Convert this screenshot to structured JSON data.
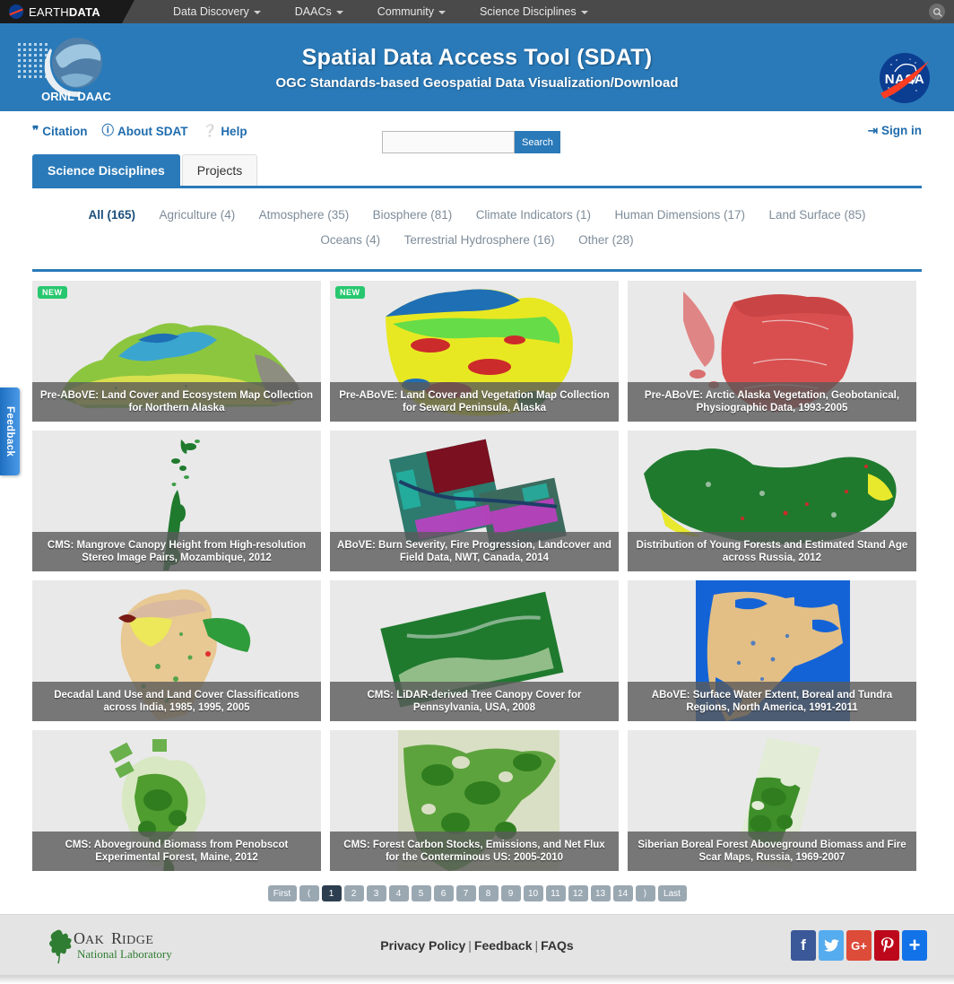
{
  "earthdata_bar": {
    "logo_text_light": "EARTH",
    "logo_text_bold": "DATA",
    "nav": [
      {
        "label": "Data Discovery",
        "has_caret": true
      },
      {
        "label": "DAACs",
        "has_caret": true
      },
      {
        "label": "Community",
        "has_caret": true
      },
      {
        "label": "Science Disciplines",
        "has_caret": true
      }
    ],
    "search_icon": "search-icon"
  },
  "banner": {
    "title": "Spatial Data Access Tool (SDAT)",
    "subtitle": "OGC Standards-based Geospatial Data Visualization/Download",
    "ornl_label": "ORNL DAAC",
    "nasa_label": "NASA",
    "background_color": "#2a7ab9"
  },
  "utility": {
    "links": [
      {
        "label": "Citation",
        "icon": "quote-icon"
      },
      {
        "label": "About SDAT",
        "icon": "info-circle-icon"
      },
      {
        "label": "Help",
        "icon": "question-circle-icon"
      }
    ],
    "sign_in": {
      "label": "Sign in",
      "icon": "sign-in-icon"
    },
    "link_color": "#1f6cad"
  },
  "search": {
    "value": "",
    "placeholder": "",
    "button_label": "Search"
  },
  "tabs": [
    {
      "label": "Science Disciplines",
      "active": true
    },
    {
      "label": "Projects",
      "active": false
    }
  ],
  "filters": [
    {
      "label": "All (165)",
      "active": true
    },
    {
      "label": "Agriculture (4)",
      "active": false
    },
    {
      "label": "Atmosphere (35)",
      "active": false
    },
    {
      "label": "Biosphere (81)",
      "active": false
    },
    {
      "label": "Climate Indicators (1)",
      "active": false
    },
    {
      "label": "Human Dimensions (17)",
      "active": false
    },
    {
      "label": "Land Surface (85)",
      "active": false
    },
    {
      "label": "Oceans (4)",
      "active": false
    },
    {
      "label": "Terrestrial Hydrosphere (16)",
      "active": false
    },
    {
      "label": "Other (28)",
      "active": false
    }
  ],
  "cards": [
    {
      "title": "Pre-ABoVE: Land Cover and Ecosystem Map Collection for Northern Alaska",
      "badge": "NEW"
    },
    {
      "title": "Pre-ABoVE: Land Cover and Vegetation Map Collection for Seward Peninsula, Alaska",
      "badge": "NEW"
    },
    {
      "title": "Pre-ABoVE: Arctic Alaska Vegetation, Geobotanical, Physiographic Data, 1993-2005",
      "badge": ""
    },
    {
      "title": "CMS: Mangrove Canopy Height from High-resolution Stereo Image Pairs, Mozambique, 2012",
      "badge": ""
    },
    {
      "title": "ABoVE: Burn Severity, Fire Progression, Landcover and Field Data, NWT, Canada, 2014",
      "badge": ""
    },
    {
      "title": "Distribution of Young Forests and Estimated Stand Age across Russia, 2012",
      "badge": ""
    },
    {
      "title": "Decadal Land Use and Land Cover Classifications across India, 1985, 1995, 2005",
      "badge": ""
    },
    {
      "title": "CMS: LiDAR-derived Tree Canopy Cover for Pennsylvania, USA, 2008",
      "badge": ""
    },
    {
      "title": "ABoVE: Surface Water Extent, Boreal and Tundra Regions, North America, 1991-2011",
      "badge": ""
    },
    {
      "title": "CMS: Aboveground Biomass from Penobscot Experimental Forest, Maine, 2012",
      "badge": ""
    },
    {
      "title": "CMS: Forest Carbon Stocks, Emissions, and Net Flux for the Conterminous US: 2005-2010",
      "badge": ""
    },
    {
      "title": "Siberian Boreal Forest Aboveground Biomass and Fire Scar Maps, Russia, 1969-2007",
      "badge": ""
    }
  ],
  "pagination": {
    "first_label": "First",
    "prev_icon": "chevron-left-icon",
    "pages": [
      "1",
      "2",
      "3",
      "4",
      "5",
      "6",
      "7",
      "8",
      "9",
      "10",
      "11",
      "12",
      "13",
      "14"
    ],
    "current_page": "1",
    "next_icon": "chevron-right-icon",
    "last_label": "Last"
  },
  "footer": {
    "ornl_line1": "OAK RIDGE",
    "ornl_line2": "National Laboratory",
    "links": [
      {
        "label": "Privacy Policy"
      },
      {
        "label": "Feedback"
      },
      {
        "label": "FAQs"
      }
    ],
    "separator": "|",
    "social": [
      {
        "name": "facebook",
        "glyph": "f",
        "color": "#3b5998"
      },
      {
        "name": "twitter",
        "glyph": "ᴠ",
        "color": "#55acee"
      },
      {
        "name": "google-plus",
        "glyph": "G+",
        "color": "#dd4b39"
      },
      {
        "name": "pinterest",
        "glyph": "ℙ",
        "color": "#bd081c"
      },
      {
        "name": "share-more",
        "glyph": "+",
        "color": "#1272e8"
      }
    ]
  },
  "feedback_tab": {
    "label": "Feedback"
  }
}
